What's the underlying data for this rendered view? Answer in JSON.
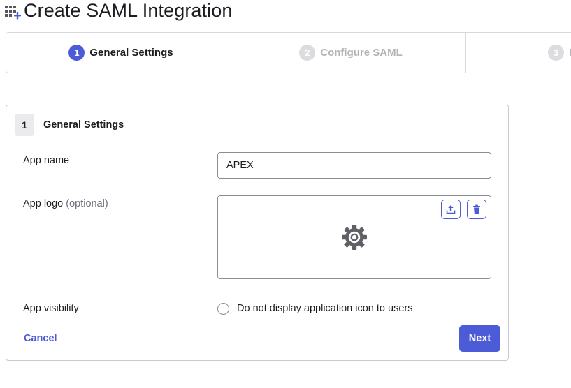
{
  "page": {
    "title": "Create SAML Integration",
    "title_icon": "apps-add-icon"
  },
  "stepper": {
    "steps": [
      {
        "number": "1",
        "label": "General Settings",
        "state": "active"
      },
      {
        "number": "2",
        "label": "Configure SAML",
        "state": "inactive"
      },
      {
        "number": "3",
        "label": "F",
        "state": "inactive"
      }
    ]
  },
  "card": {
    "number": "1",
    "title": "General Settings",
    "app_name": {
      "label": "App name",
      "value": "APEX"
    },
    "app_logo": {
      "label": "App logo",
      "optional": "(optional)",
      "upload_icon": "upload-icon",
      "delete_icon": "trash-icon",
      "placeholder_icon": "gear-icon"
    },
    "app_visibility": {
      "label": "App visibility",
      "checkbox_label": "Do not display application icon to users",
      "checked": false
    },
    "cancel_label": "Cancel",
    "next_label": "Next"
  },
  "colors": {
    "accent": "#4b5cd6",
    "border": "#d7d7dc",
    "text": "#1d1d21",
    "muted": "#b3b3b8",
    "gear": "#5f5f66"
  }
}
